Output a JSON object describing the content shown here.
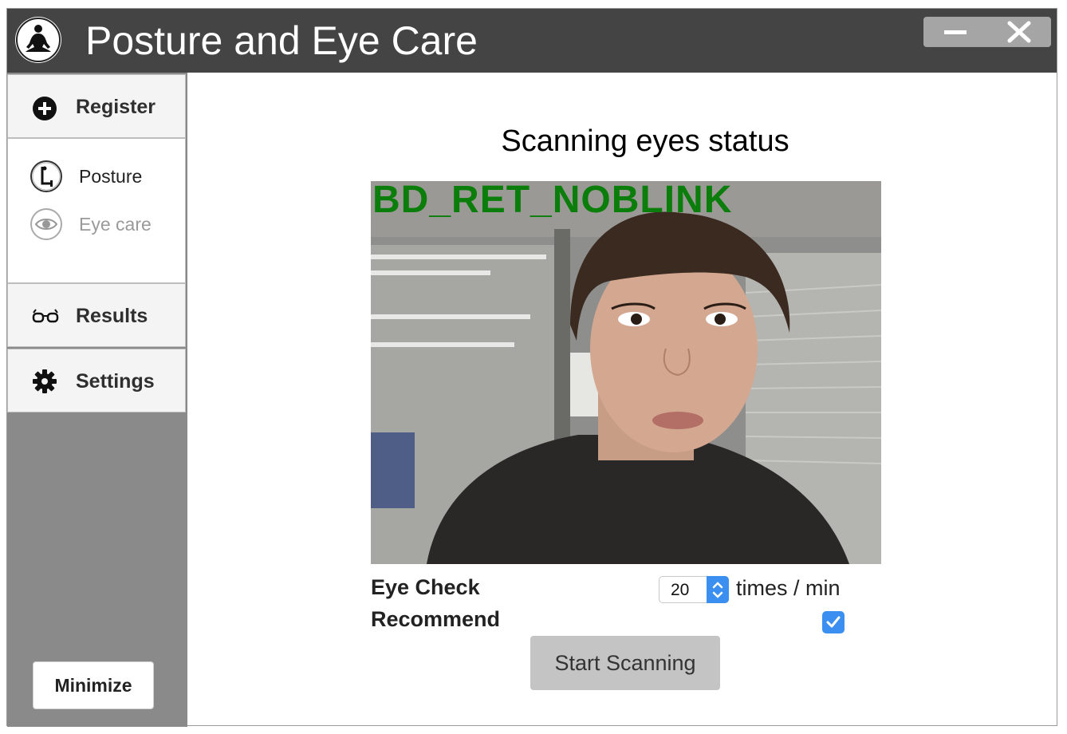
{
  "window": {
    "title": "Posture and Eye Care"
  },
  "sidebar": {
    "register_label": "Register",
    "sub_items": [
      {
        "label": "Posture",
        "state": "active"
      },
      {
        "label": "Eye care",
        "state": "muted"
      }
    ],
    "results_label": "Results",
    "settings_label": "Settings",
    "minimize_label": "Minimize"
  },
  "main": {
    "title": "Scanning eyes status",
    "camera_status": "BD_RET_NOBLINK",
    "eye_check_label": "Eye Check",
    "eye_check_value": "20",
    "eye_check_unit": "times / min",
    "recommend_label": "Recommend",
    "recommend_checked": true,
    "start_button_label": "Start Scanning"
  },
  "colors": {
    "titlebar": "#444444",
    "sidebar_bg": "#8a8a8a",
    "accent_blue": "#3b8ff0",
    "status_green": "#0a7d0a",
    "muted_text": "#9a9a9a"
  }
}
